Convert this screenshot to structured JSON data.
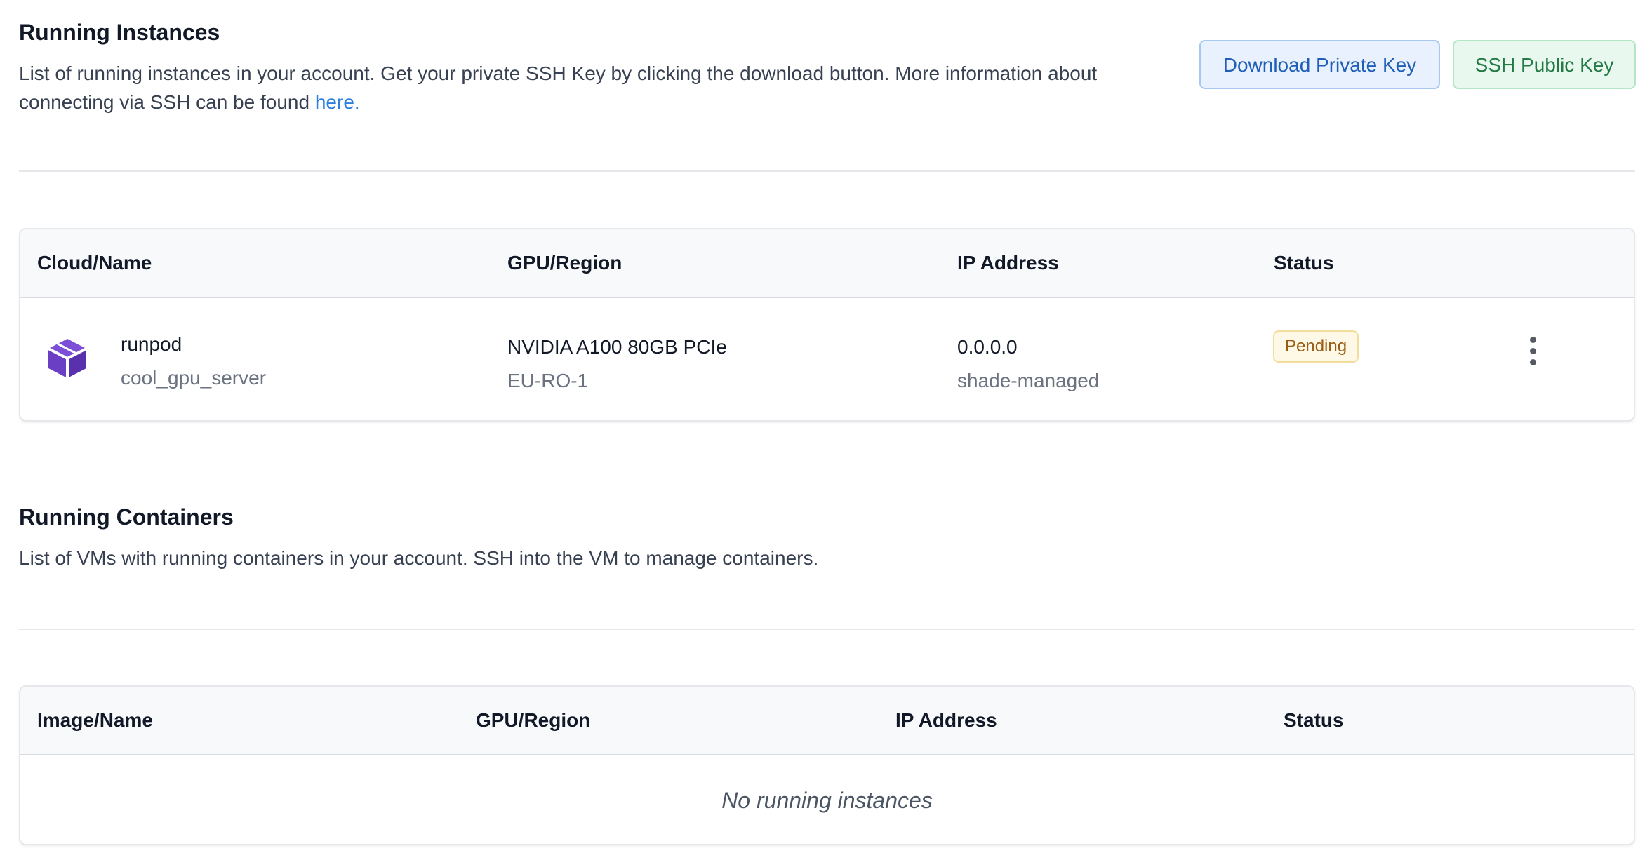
{
  "instances": {
    "title": "Running Instances",
    "description": "List of running instances in your account. Get your private SSH Key by clicking the download button. More information about connecting via SSH can be found ",
    "link_text": "here.",
    "download_key_label": "Download Private Key",
    "ssh_public_key_label": "SSH Public Key",
    "columns": [
      "Cloud/Name",
      "GPU/Region",
      "IP Address",
      "Status"
    ],
    "rows": [
      {
        "icon": "cube-icon",
        "cloud": "runpod",
        "name": "cool_gpu_server",
        "gpu": "NVIDIA A100 80GB PCIe",
        "region": "EU-RO-1",
        "ip": "0.0.0.0",
        "ip_type": "shade-managed",
        "status": "Pending"
      }
    ]
  },
  "containers": {
    "title": "Running Containers",
    "description": "List of VMs with running containers in your account. SSH into the VM to manage containers.",
    "columns": [
      "Image/Name",
      "GPU/Region",
      "IP Address",
      "Status"
    ],
    "empty_text": "No running instances"
  },
  "colors": {
    "link": "#2b7fe0",
    "cube_icon": "#6b3fc4",
    "pending_badge_bg": "#fef9e7",
    "pending_badge_text": "#9a5b12"
  }
}
